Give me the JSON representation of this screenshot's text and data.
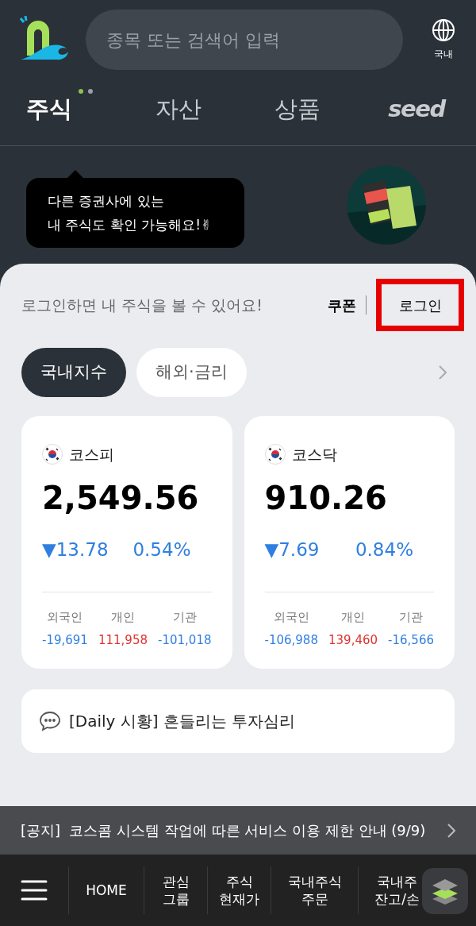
{
  "header": {
    "search": {
      "placeholder": "종목 또는 검색어 입력"
    },
    "region": {
      "label": "국내"
    }
  },
  "tabs": [
    {
      "label": "주식",
      "selected": true,
      "dots": true
    },
    {
      "label": "자산",
      "selected": false
    },
    {
      "label": "상품",
      "selected": false
    },
    {
      "label": "seed",
      "selected": false,
      "kind": "logo"
    }
  ],
  "tooltip": {
    "lines": [
      "다른 증권사에 있는",
      "내 주식도 확인 가능해요!✌"
    ]
  },
  "login_bar": {
    "message": "로그인하면 내 주식을 볼 수 있어요!",
    "coupon": "쿠폰",
    "login": {
      "label": "로그인",
      "highlighted": true
    }
  },
  "index_tabs": [
    {
      "label": "국내지수",
      "selected": true
    },
    {
      "label": "해외·금리",
      "selected": false
    }
  ],
  "index_cards": [
    {
      "name": "코스피",
      "value": "2,549.56",
      "change": "▼13.78",
      "rate": "0.54%",
      "color": "#2f7fe0",
      "investors": [
        {
          "label": "외국인",
          "value": "-19,691",
          "color": "#2f7fe0"
        },
        {
          "label": "개인",
          "value": "111,958",
          "color": "#e0312f"
        },
        {
          "label": "기관",
          "value": "-101,018",
          "color": "#2f7fe0"
        }
      ]
    },
    {
      "name": "코스닥",
      "value": "910.26",
      "change": "▼7.69",
      "rate": "0.84%",
      "color": "#2f7fe0",
      "investors": [
        {
          "label": "외국인",
          "value": "-106,988",
          "color": "#2f7fe0"
        },
        {
          "label": "개인",
          "value": "139,460",
          "color": "#e0312f"
        },
        {
          "label": "기관",
          "value": "-16,566",
          "color": "#2f7fe0"
        }
      ]
    }
  ],
  "news": {
    "text": "[Daily 시황] 흔들리는 투자심리"
  },
  "notice": {
    "text": "[공지]  코스콤 시스템 작업에 따른 서비스 이용 제한 안내 (9/9)"
  },
  "bottom_nav": [
    {
      "label": "HOME"
    },
    {
      "label": "관심\n그룹"
    },
    {
      "label": "주식\n현재가"
    },
    {
      "label": "국내주식\n주문"
    },
    {
      "label": "국내주\n잔고/손"
    }
  ]
}
